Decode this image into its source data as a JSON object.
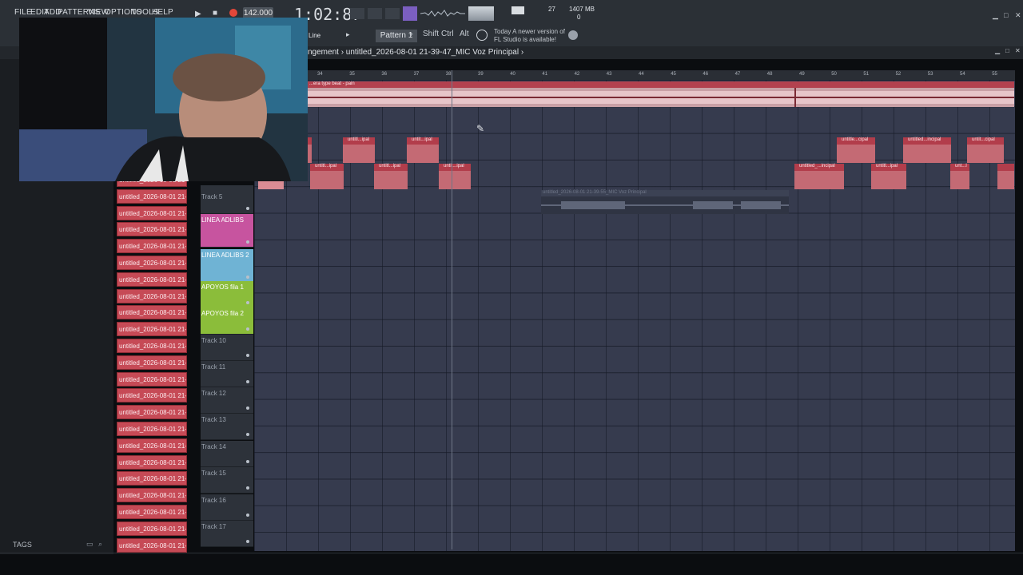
{
  "menu": [
    "FILE",
    "EDIT",
    "ADD",
    "PATTERNS",
    "VIEW",
    "OPTIONS",
    "TOOLS",
    "HELP"
  ],
  "transport": {
    "tempo": "142.000",
    "time": "1:02:87",
    "cpu": "27",
    "memory": "1407 MB",
    "voices": "0"
  },
  "toolbar": {
    "mode": "Line",
    "pattern": "Pattern 1",
    "shift": "Shift",
    "ctrl": "Ctrl",
    "alt": "Alt"
  },
  "news": {
    "when": "Today",
    "line1": "A newer version of",
    "line2": "FL Studio is available!"
  },
  "playlist": {
    "breadcrumb": "ngement › untitled_2026-08-01 21-39-47_MIC Voz Principal ›",
    "ruler_ticks": [
      "34",
      "35",
      "36",
      "37",
      "38",
      "39",
      "40",
      "41",
      "42",
      "43",
      "44",
      "45",
      "46",
      "47",
      "48",
      "49",
      "50",
      "51",
      "52",
      "53",
      "54",
      "55"
    ],
    "beat_clip_label": "...era type beat - pain",
    "clip_labels": {
      "row1a": "untitl...ipal",
      "row1b": "untit...ipal",
      "row1c": "untitle...cipal",
      "row1d": "untitled...incipal",
      "row1e": "untit...cipal",
      "row2a": "untitl...ipal",
      "row2b": "untitl...ipal",
      "row2c": "untit...ipal",
      "row2d": "untitled_...incipal",
      "row2e": "untitl...ipal",
      "row2f": "unt...l",
      "muted": "untitled_2026-08-01 21-39-55_MIC Voz Principal"
    }
  },
  "tracks": [
    {
      "name": "Track 5"
    },
    {
      "name": "LINEA ADLIBS",
      "color": "#c7549f"
    },
    {
      "name": "LINEA ADLIBS 2",
      "color": "#6fb3d4"
    },
    {
      "name": "APOYOS fila 1",
      "color": "#8bbd3a"
    },
    {
      "name": "APOYOS fila 2",
      "color": "#8bbd3a"
    },
    {
      "name": "Track 10"
    },
    {
      "name": "Track 11"
    },
    {
      "name": "Track 12"
    },
    {
      "name": "Track 13"
    },
    {
      "name": "Track 14"
    },
    {
      "name": "Track 15"
    },
    {
      "name": "Track 16"
    },
    {
      "name": "Track 17"
    }
  ],
  "clip_list": [
    "untitled_2026-08-01 21-",
    "untitled_2026-08-01 21-",
    "untitled_2026-08-01 21-",
    "untitled_2026-08-01 21-",
    "untitled_2026-08-01 21-",
    "untitled_2026-08-01 21-",
    "untitled_2026-08-01 21-",
    "untitled_2026-08-01 21-",
    "untitled_2026-08-01 21-",
    "untitled_2026-08-01 21-",
    "untitled_2026-08-01 21-",
    "untitled_2026-08-01 21-",
    "untitled_2026-08-01 21-",
    "untitled_2026-08-01 21-",
    "untitled_2026-08-01 21-",
    "untitled_2026-08-01 21-",
    "untitled_2026-08-01 21-",
    "untitled_2026-08-01 21-",
    "untitled_2026-08-01 21-",
    "untitled_2026-08-01 21-",
    "untitled_2026-08-01 21-",
    "untitled_2026-08-01 21-",
    "untitled_2026-08-01 21-"
  ],
  "browser": {
    "tags": "TAGS"
  }
}
